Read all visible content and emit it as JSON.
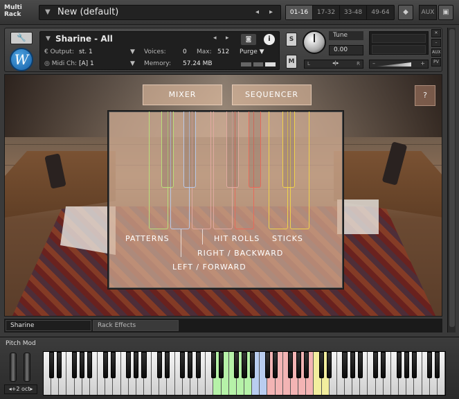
{
  "topbar": {
    "multi_rack_label_line1": "Multi",
    "multi_rack_label_line2": "Rack",
    "preset_name": "New (default)",
    "rack_tabs": [
      "01-16",
      "17-32",
      "33-48",
      "49-64"
    ],
    "active_rack_tab": "01-16",
    "aux_label": "AUX"
  },
  "instrument": {
    "name": "Sharine - All",
    "output_label": "Output:",
    "output_value": "st. 1",
    "midi_label": "Midi Ch:",
    "midi_value": "[A]  1",
    "voices_label": "Voices:",
    "voices_value": "0",
    "max_label": "Max:",
    "max_value": "512",
    "memory_label": "Memory:",
    "memory_value": "57.24 MB",
    "purge_label": "Purge",
    "solo_label": "S",
    "mute_label": "M",
    "tune_label": "Tune",
    "tune_value": "0.00",
    "pan_left": "L",
    "pan_right": "R",
    "aux_small": "AUX",
    "pv_small": "PV",
    "logo_letter": "W"
  },
  "stage": {
    "mixer_label": "MIXER",
    "sequencer_label": "SEQUENCER",
    "help_label": "?",
    "labels": {
      "patterns": "PATTERNS",
      "left_forward": "LEFT / FORWARD",
      "right_backward": "RIGHT / BACKWARD",
      "hit_rolls": "HIT ROLLS",
      "sticks": "STICKS"
    }
  },
  "bottom_tabs": {
    "instrument_tab": "Sharine",
    "rack_effects_tab": "Rack Effects"
  },
  "keyboard": {
    "pitch_mod_label": "Pitch Mod",
    "octave_label": "+2 oct",
    "zones": {
      "green": "#b6f2a8",
      "blue": "#b9cdf0",
      "red": "#f3b4b4",
      "yellow": "#f2ee9e"
    }
  },
  "colors": {
    "outline_green": "#b9e07a",
    "outline_blue": "#b9c9e8",
    "outline_red": "#e86a5a",
    "outline_yellow": "#f0d34a"
  }
}
